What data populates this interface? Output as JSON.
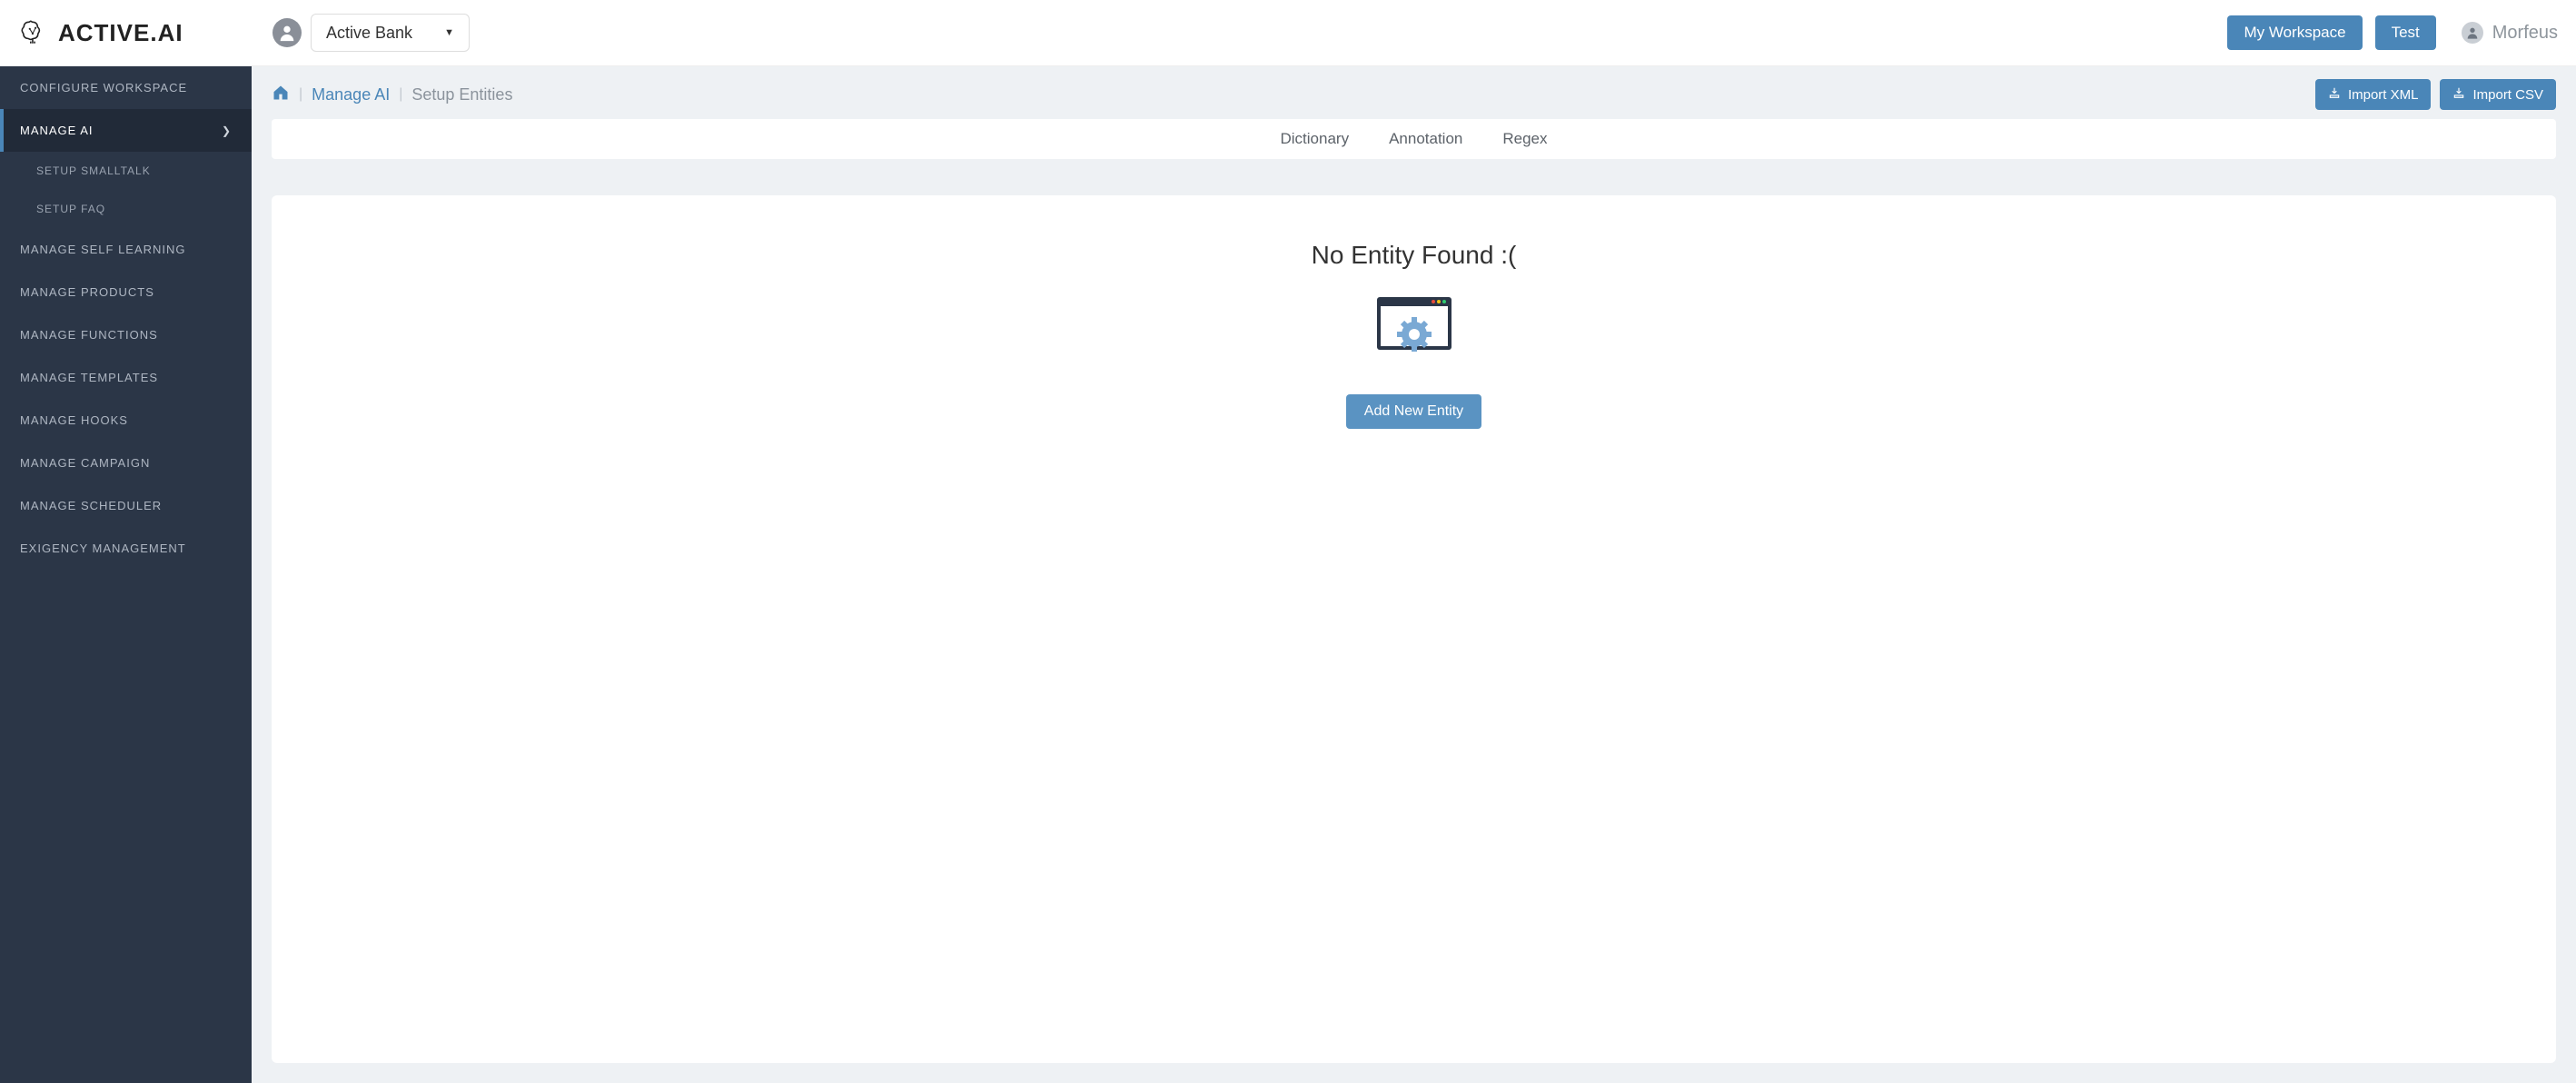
{
  "brand": {
    "name": "ACTIVE.AI"
  },
  "workspace_selector": {
    "selected": "Active Bank"
  },
  "header": {
    "my_workspace": "My Workspace",
    "test": "Test",
    "user_name": "Morfeus"
  },
  "sidebar": {
    "items": [
      {
        "label": "Configure Workspace",
        "active": false
      },
      {
        "label": "Manage AI",
        "active": true,
        "has_children": true
      },
      {
        "label": "Manage Self Learning",
        "active": false
      },
      {
        "label": "Manage Products",
        "active": false
      },
      {
        "label": "Manage Functions",
        "active": false
      },
      {
        "label": "Manage Templates",
        "active": false
      },
      {
        "label": "Manage Hooks",
        "active": false
      },
      {
        "label": "Manage Campaign",
        "active": false
      },
      {
        "label": "Manage Scheduler",
        "active": false
      },
      {
        "label": "Exigency Management",
        "active": false
      }
    ],
    "sub_items": [
      {
        "label": "Setup Smalltalk"
      },
      {
        "label": "Setup FAQ"
      }
    ]
  },
  "breadcrumb": {
    "link": "Manage AI",
    "current": "Setup Entities"
  },
  "actions": {
    "import_xml": "Import XML",
    "import_csv": "Import CSV"
  },
  "tabs": [
    {
      "label": "Dictionary"
    },
    {
      "label": "Annotation"
    },
    {
      "label": "Regex"
    }
  ],
  "empty_state": {
    "title": "No Entity Found :(",
    "add_button": "Add New Entity"
  }
}
